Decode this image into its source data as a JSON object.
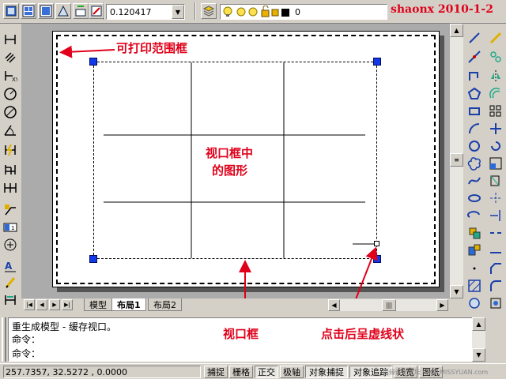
{
  "toolbar": {
    "scale_value": "0.120417",
    "layer_name": "0",
    "watermark": "shaonx 2010-1-2"
  },
  "annotations": {
    "print_frame": "可打印范围框",
    "viewport_content": [
      "视口框中",
      "的图形"
    ],
    "viewport_frame": "视口框",
    "click_dashed": "点击后呈虚线状"
  },
  "tabs": [
    {
      "label": "模型",
      "active": false
    },
    {
      "label": "布局1",
      "active": true
    },
    {
      "label": "布局2",
      "active": false
    }
  ],
  "command": {
    "history": "重生成模型 - 缓存视口。",
    "line1": "命令：",
    "line2": "命令："
  },
  "status": {
    "coords": "257.7357, 32.5272 , 0.0000",
    "buttons": [
      "捕捉",
      "栅格",
      "正交",
      "极轴",
      "对象捕捉",
      "对象追踪",
      "线宽",
      "图纸"
    ],
    "site_watermark": "思缘设计论坛 www.MISSYUAN.com"
  },
  "colors": {
    "annotation": "#e0001a",
    "grip": "#1238e8",
    "model_bg": "#ababab",
    "ui_bg": "#d4d0c8"
  },
  "icons": {
    "left_toolbar": [
      "linear-dimension-icon",
      "aligned-dimension-icon",
      "ordinate-dimension-icon",
      "radius-dimension-icon",
      "diameter-dimension-icon",
      "angular-dimension-icon",
      "quick-dimension-icon",
      "baseline-dimension-icon",
      "continue-dimension-icon",
      "leader-icon",
      "tolerance-icon",
      "center-mark-icon",
      "dimension-edit-icon",
      "dimension-text-edit-icon",
      "dimension-update-icon"
    ],
    "right_toolbar": [
      "line-icon",
      "construction-line-icon",
      "polyline-icon",
      "polygon-icon",
      "rectangle-icon",
      "arc-icon",
      "circle-icon",
      "revision-cloud-icon",
      "spline-icon",
      "ellipse-icon",
      "ellipse-arc-icon",
      "insert-block-icon",
      "make-block-icon",
      "point-icon",
      "hatch-icon",
      "region-icon"
    ]
  }
}
